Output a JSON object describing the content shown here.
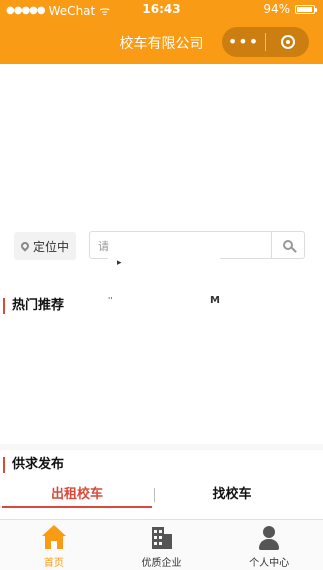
{
  "status_bar": {
    "signal": "●●●●●",
    "carrier": "WeChat",
    "wifi_symbol": "ᯤ",
    "time": "16:43",
    "battery_percent": "94%",
    "battery_level": 0.94
  },
  "nav": {
    "title": "校车有限公司",
    "more_label": "•••"
  },
  "search_row": {
    "locate_label": "定位中",
    "search_placeholder": "请"
  },
  "overlay_marks": {
    "mark1": "▸",
    "mark2": "''",
    "mark3": "M"
  },
  "sections": {
    "hot": {
      "title": "热门推荐"
    },
    "supply": {
      "title": "供求发布"
    }
  },
  "tabs": [
    {
      "label": "出租校车",
      "active": true
    },
    {
      "label": "找校车",
      "active": false
    }
  ],
  "tabbar": [
    {
      "label": "首页",
      "icon": "home-icon",
      "active": true
    },
    {
      "label": "优质企业",
      "icon": "building-icon",
      "active": false
    },
    {
      "label": "个人中心",
      "icon": "person-icon",
      "active": false
    }
  ],
  "colors": {
    "brand": "#f99b14",
    "accent": "#d94a3a"
  }
}
